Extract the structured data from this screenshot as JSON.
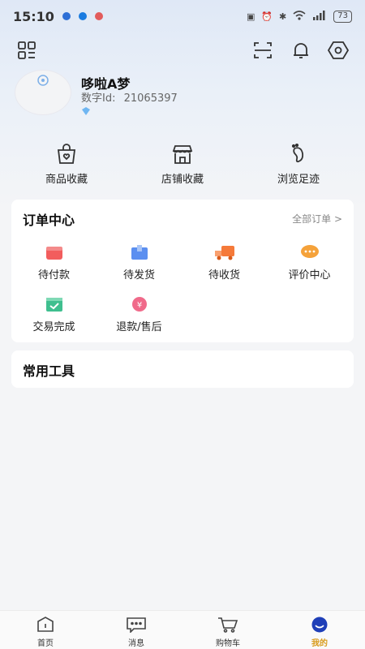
{
  "status_bar": {
    "time": "15:10",
    "battery": "73"
  },
  "profile": {
    "username": "哆啦A梦",
    "id_label": "数字Id:",
    "id_value": "21065397"
  },
  "quick_links": [
    {
      "label": "商品收藏",
      "icon": "bag-heart-icon"
    },
    {
      "label": "店铺收藏",
      "icon": "store-icon"
    },
    {
      "label": "浏览足迹",
      "icon": "footprint-icon"
    }
  ],
  "order_center": {
    "title": "订单中心",
    "all_orders_link": "全部订单 >",
    "items": [
      {
        "label": "待付款",
        "icon": "wallet-icon",
        "color": "#f25d5d"
      },
      {
        "label": "待发货",
        "icon": "package-icon",
        "color": "#5b8ff0"
      },
      {
        "label": "待收货",
        "icon": "truck-icon",
        "color": "#f57a3a"
      },
      {
        "label": "评价中心",
        "icon": "chat-bubble-icon",
        "color": "#f5a23a"
      },
      {
        "label": "交易完成",
        "icon": "check-box-icon",
        "color": "#3fbf8f"
      },
      {
        "label": "退款/售后",
        "icon": "refund-icon",
        "color": "#f06a8a"
      }
    ]
  },
  "tools": {
    "title": "常用工具"
  },
  "bottom_nav": [
    {
      "label": "首页",
      "icon": "home-icon",
      "active": false
    },
    {
      "label": "消息",
      "icon": "message-icon",
      "active": false
    },
    {
      "label": "购物车",
      "icon": "cart-icon",
      "active": false
    },
    {
      "label": "我的",
      "icon": "profile-icon",
      "active": true
    }
  ],
  "colors": {
    "accent": "#d89b1c",
    "nav_active_icon": "#1f3fb8"
  }
}
